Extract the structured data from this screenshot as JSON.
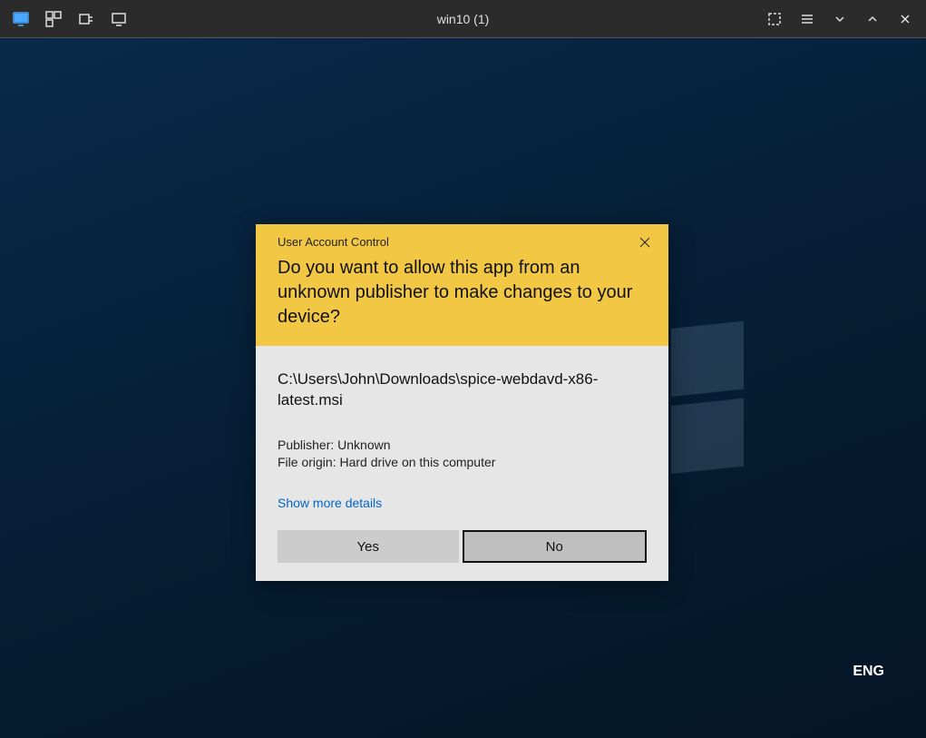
{
  "vm": {
    "title": "win10 (1)"
  },
  "uac": {
    "title": "User Account Control",
    "question": "Do you want to allow this app from an unknown publisher to make changes to your device?",
    "path": "C:\\Users\\John\\Downloads\\spice-webdavd-x86-latest.msi",
    "publisher_line": "Publisher: Unknown",
    "origin_line": "File origin: Hard drive on this computer",
    "details_link": "Show more details",
    "yes": "Yes",
    "no": "No"
  },
  "lang": "ENG"
}
